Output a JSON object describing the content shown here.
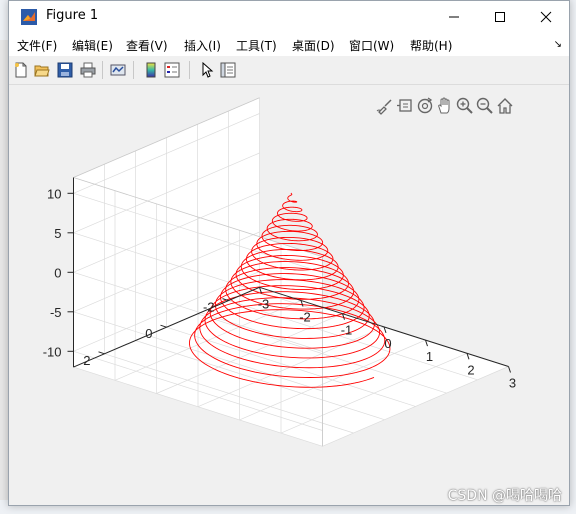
{
  "window": {
    "title": "Figure 1"
  },
  "menu": {
    "items": [
      "文件(F)",
      "编辑(E)",
      "查看(V)",
      "插入(I)",
      "工具(T)",
      "桌面(D)",
      "窗口(W)",
      "帮助(H)"
    ]
  },
  "toolbar": {
    "icons": [
      "new-figure-icon",
      "open-file-icon",
      "save-icon",
      "print-icon",
      "link-plot-icon",
      "insert-colorbar-icon",
      "insert-legend-icon",
      "edit-plot-icon",
      "property-inspector-icon"
    ]
  },
  "axes_toolbar": {
    "icons": [
      "brush-icon",
      "data-tips-icon",
      "rotate-3d-icon",
      "pan-icon",
      "zoom-in-icon",
      "zoom-out-icon",
      "home-icon"
    ]
  },
  "chart_data": {
    "type": "line",
    "title": "",
    "xlabel": "",
    "ylabel": "",
    "zlabel": "",
    "xlim": [
      -3,
      3
    ],
    "ylim": [
      -3,
      3
    ],
    "zlim": [
      -12,
      12
    ],
    "xticks": [
      "-3",
      "-2",
      "-1",
      "0",
      "1",
      "2",
      "3"
    ],
    "yticks": [
      "-2",
      "0",
      "2"
    ],
    "zticks": [
      "-10",
      "-5",
      "0",
      "5",
      "10"
    ],
    "grid": true,
    "view": {
      "azimuth": -37.5,
      "elevation": 30
    },
    "series": [
      {
        "color": "#ff0000",
        "curve": "conical helix",
        "x": "(1 - z/10) * cos(t)",
        "y": "(1 - z/10) * sin(t)",
        "z_range": [
          -10,
          10
        ],
        "turns": 20
      }
    ]
  },
  "watermark": "CSDN @喝哈喝哈"
}
